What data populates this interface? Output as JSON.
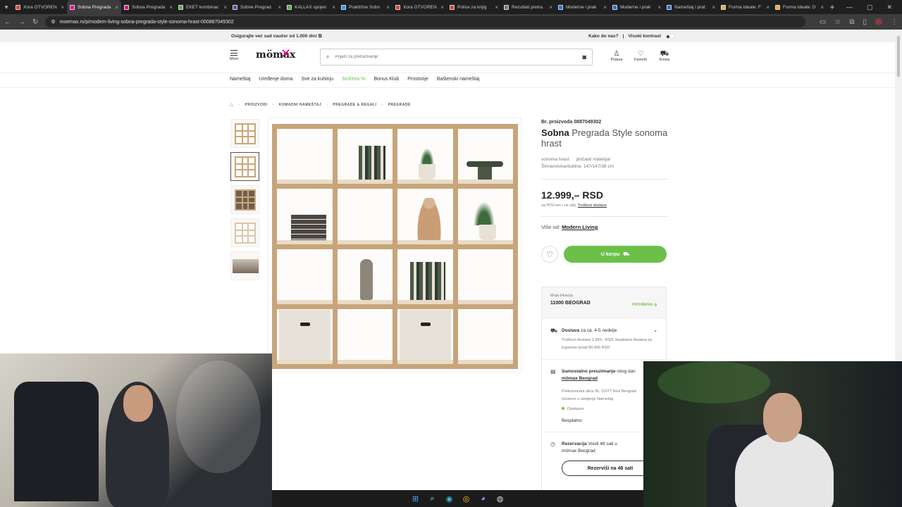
{
  "browser": {
    "tabs": [
      {
        "label": "Xora OTVOREN",
        "color": "#e53935"
      },
      {
        "label": "Sobna Pregrada",
        "color": "#e6007e",
        "active": true
      },
      {
        "label": "Sobna Pregrada",
        "color": "#e6007e"
      },
      {
        "label": "EKET kombinac",
        "color": "#4caf50"
      },
      {
        "label": "Sobne Pregrad",
        "color": "#3f51b5"
      },
      {
        "label": "KALLAX spojen",
        "color": "#4caf50"
      },
      {
        "label": "Praktične Sobn",
        "color": "#2196f3"
      },
      {
        "label": "Xora OTVOREN",
        "color": "#e53935"
      },
      {
        "label": "Police za knjig",
        "color": "#e53935"
      },
      {
        "label": "Rezultati pretra",
        "color": "#607d8b"
      },
      {
        "label": "Moderne i prak",
        "color": "#1976d2"
      },
      {
        "label": "Moderne i prak",
        "color": "#1976d2"
      },
      {
        "label": "Nameštaj i prat",
        "color": "#1976d2"
      },
      {
        "label": "Forma Ideale: F",
        "color": "#f9a825"
      },
      {
        "label": "Forma Ideale: D",
        "color": "#f9a825"
      }
    ],
    "url": "moemax.rs/p/modern-living-sobna-pregrada-style-sonoma-hrast-000887049302"
  },
  "site": {
    "promo_left": "Osigurajte već sad vaučer od 1.000 din!",
    "promo_help": "Kako do nas?",
    "promo_contrast": "Visoki kontrast",
    "menu_label": "Meni",
    "logo": "mömax",
    "search_placeholder": "Pojam za pretraživanje",
    "header_icons": [
      {
        "label": "Prijava",
        "icon": "user-icon"
      },
      {
        "label": "Favoriti",
        "icon": "heart-icon"
      },
      {
        "label": "Korpa",
        "icon": "cart-icon"
      }
    ],
    "nav": [
      "Nameštaj",
      "Uređenje doma",
      "Sve za kuhinju",
      "Sniženo %",
      "Bonus Klub",
      "Prostorije",
      "Baštenski nameštaj"
    ],
    "breadcrumbs": [
      "PROIZVODI",
      "KOMADNI NAMEŠTAJ",
      "PREGRADE & REGALI",
      "PREGRADE"
    ]
  },
  "product": {
    "sku": "Br. proizvoda 0887049302",
    "title_bold": "Sobna",
    "title_rest": "Pregrada Style sonoma hrast",
    "attr1": "sonoma hrast",
    "attr2": "pločasti materijal",
    "dims": "Širina/visina/dubina: 147/147/38 cm",
    "price": "12.999,– RSD",
    "price_note": "sa PDV-om • ne uklj.",
    "shipping_link": "Troškovi dostave",
    "brand_prefix": "Više od:",
    "brand": "Modern Living",
    "cart_button": "U korpu"
  },
  "availability": {
    "location_label": "Moja lokacija",
    "location": "11000 BEOGRAD",
    "change": "PROMENA",
    "delivery_title": "Dostava",
    "delivery_eta": "za ca. 4-5 nedelje",
    "delivery_note": "Troškovi dostave 2.999,- RSD, besplatna dostava za kupovine iznad 80.000 RSD",
    "pickup_title": "Samostalno preuzimanje",
    "pickup_rest": "istog dan",
    "pickup_store": "mömax Beograd",
    "pickup_address": "Prekomorska ulica 36, 11077 Novi Beograd",
    "pickup_dept": "Izlozeno u odeljenje Nameštaj",
    "pickup_status": "Dostupno",
    "pickup_price": "Besplatno",
    "reservation_title": "Rezervacija",
    "reservation_rest": "Vredi 48 sati u",
    "reservation_store": "mömax Beograd",
    "reservation_button": "Rezerviši na 48 sati"
  }
}
